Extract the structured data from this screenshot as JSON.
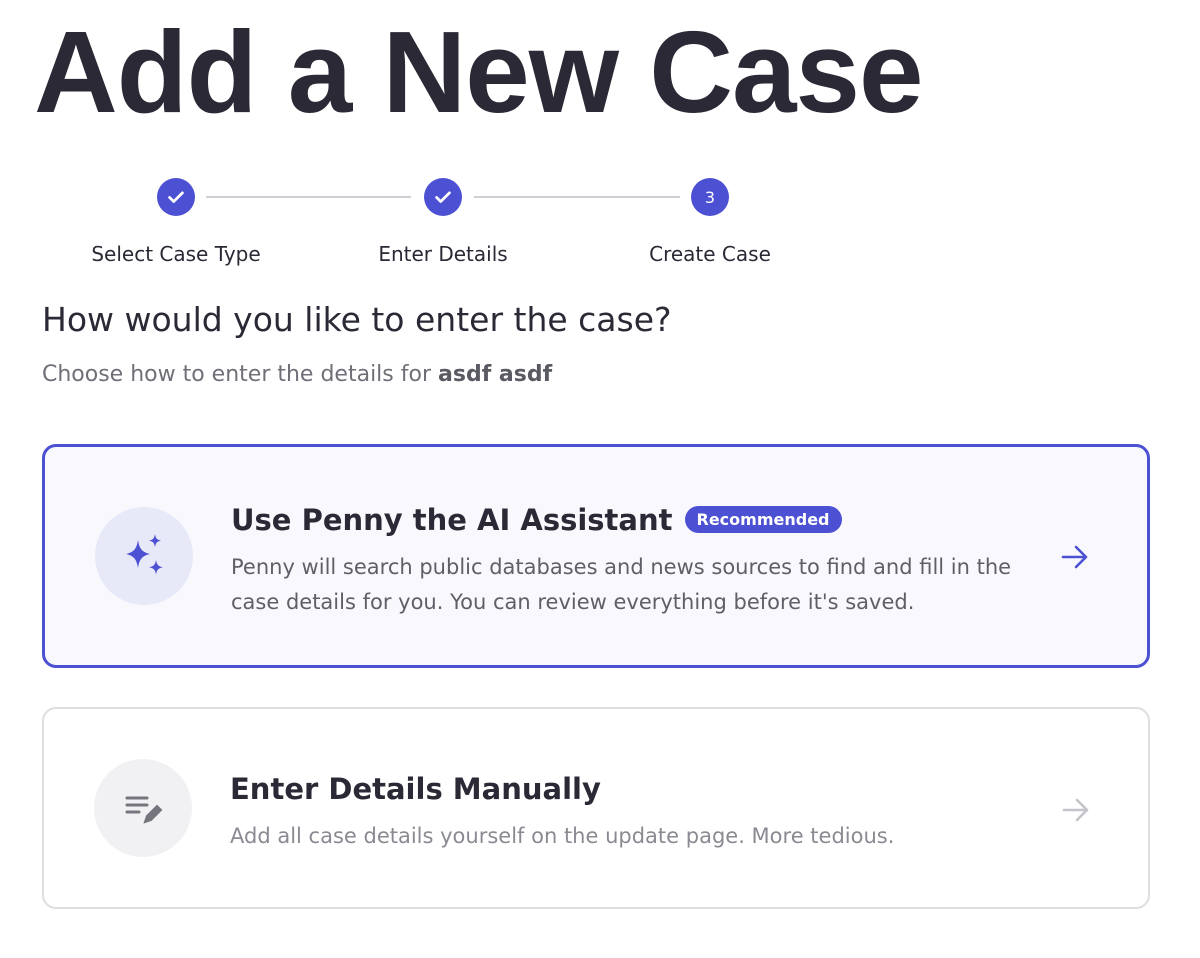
{
  "page": {
    "title": "Add a New Case"
  },
  "stepper": {
    "steps": [
      {
        "label": "Select Case Type",
        "state": "complete"
      },
      {
        "label": "Enter Details",
        "state": "complete"
      },
      {
        "label": "Create Case",
        "state": "current",
        "number": "3"
      }
    ]
  },
  "main": {
    "question": "How would you like to enter the case?",
    "subtitle_prefix": "Choose how to enter the details for",
    "case_name": "asdf asdf"
  },
  "options": {
    "ai": {
      "title": "Use Penny the AI Assistant",
      "badge": "Recommended",
      "description": "Penny will search public databases and news sources to find and fill in the case details for you. You can review everything before it's saved.",
      "icon": "sparkles-icon"
    },
    "manual": {
      "title": "Enter Details Manually",
      "description": "Add all case details yourself on the update page. More tedious.",
      "icon": "edit-notes-icon"
    }
  },
  "colors": {
    "accent": "#4c50d2",
    "title_text": "#2a2935",
    "muted_text": "#6f6f78",
    "card_border_inactive": "#dedee2"
  }
}
